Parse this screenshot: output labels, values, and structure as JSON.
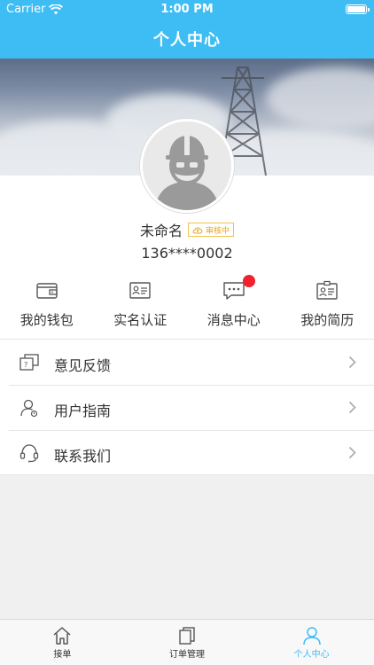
{
  "status_bar": {
    "carrier": "Carrier",
    "time": "1:00 PM"
  },
  "nav": {
    "title": "个人中心"
  },
  "profile": {
    "name": "未命名",
    "badge": "审核中",
    "phone": "136****0002"
  },
  "quick_menu": [
    {
      "label": "我的钱包",
      "icon": "wallet-icon"
    },
    {
      "label": "实名认证",
      "icon": "id-card-icon"
    },
    {
      "label": "消息中心",
      "icon": "message-icon",
      "has_notification": true
    },
    {
      "label": "我的简历",
      "icon": "resume-icon"
    }
  ],
  "list": [
    {
      "label": "意见反馈",
      "icon": "feedback-icon"
    },
    {
      "label": "用户指南",
      "icon": "user-guide-icon"
    },
    {
      "label": "联系我们",
      "icon": "headset-icon"
    }
  ],
  "tabs": [
    {
      "label": "接单",
      "icon": "home-icon",
      "active": false
    },
    {
      "label": "订单管理",
      "icon": "orders-icon",
      "active": false
    },
    {
      "label": "个人中心",
      "icon": "person-icon",
      "active": true
    }
  ],
  "colors": {
    "accent": "#3ebdf4",
    "badge": "#e3a722",
    "notification": "#f2212f"
  }
}
